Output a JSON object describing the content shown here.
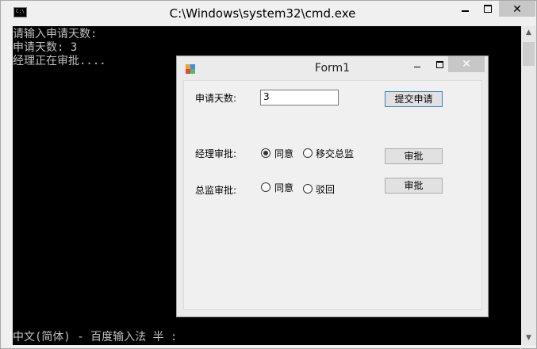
{
  "cmd": {
    "title": "C:\\Windows\\system32\\cmd.exe",
    "icon_label": "C:\\",
    "close_glyph": "✕",
    "lines": [
      "请输入申请天数:",
      "申请天数: 3",
      "经理正在审批...."
    ],
    "status_line": "中文(简体) - 百度输入法 半 :",
    "scroll_up": "▲",
    "scroll_down": "▼"
  },
  "form1": {
    "title": "Form1",
    "close_glyph": "✕",
    "days_label": "申请天数:",
    "days_value": "3",
    "submit_button": "提交申请",
    "manager": {
      "label": "经理审批:",
      "options": [
        {
          "label": "同意",
          "checked": true
        },
        {
          "label": "移交总监",
          "checked": false
        }
      ],
      "button": "审批"
    },
    "director": {
      "label": "总监审批:",
      "options": [
        {
          "label": "同意",
          "checked": false
        },
        {
          "label": "驳回",
          "checked": false
        }
      ],
      "button": "审批"
    }
  },
  "colors": {
    "console_bg": "#000000",
    "console_text": "#c0c0c0",
    "window_chrome": "#f0f0f0",
    "close_hover": "#c7c7c7"
  }
}
